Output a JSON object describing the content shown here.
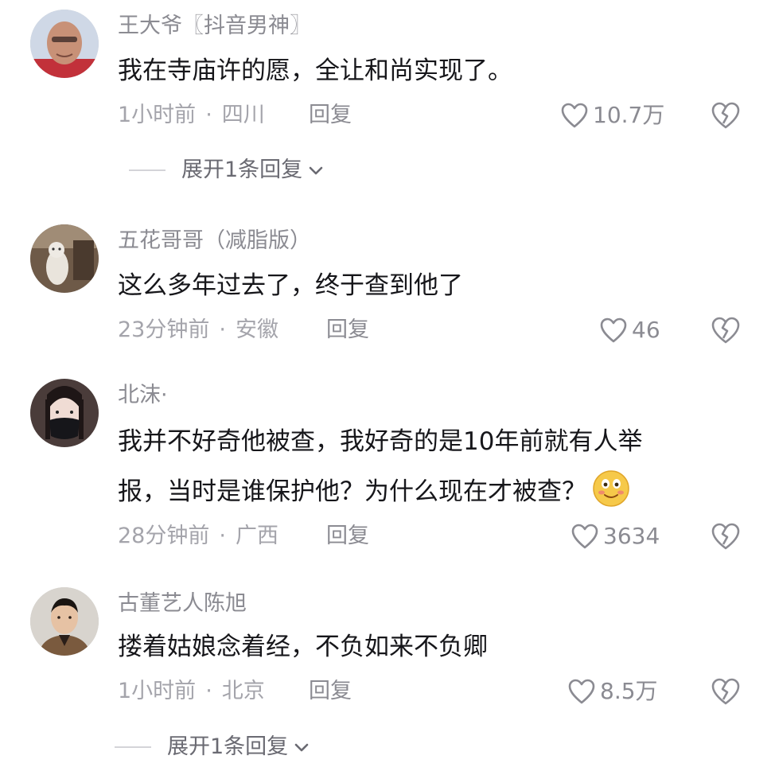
{
  "comments": [
    {
      "username": "王大爷〖抖音男神〗",
      "text_lines": [
        "我在寺庙许的愿，全让和尚实现了。"
      ],
      "time": "1小时前",
      "location": "四川",
      "reply": "回复",
      "likes": "10.7万",
      "expand": "展开1条回复"
    },
    {
      "username": "五花哥哥（减脂版）",
      "text_lines": [
        "这么多年过去了，终于查到他了"
      ],
      "time": "23分钟前",
      "location": "安徽",
      "reply": "回复",
      "likes": "46"
    },
    {
      "username": "北沫·",
      "text_lines": [
        "我并不好奇他被查，我好奇的是10年前就有人举",
        "报，当时是谁保护他？为什么现在才被查？"
      ],
      "time": "28分钟前",
      "location": "广西",
      "reply": "回复",
      "likes": "3634"
    },
    {
      "username": "古董艺人陈旭",
      "text_lines": [
        "搂着姑娘念着经，不负如来不负卿"
      ],
      "time": "1小时前",
      "location": "北京",
      "reply": "回复",
      "likes": "8.5万",
      "expand": "展开1条回复"
    }
  ],
  "icons": {
    "like": "heart-outline-icon",
    "dislike": "broken-heart-icon",
    "expand": "chevron-down-icon",
    "emoji": "smiling-face-emoji"
  },
  "colors": {
    "text": "#16161a",
    "secondary": "#8b8b92",
    "emoji_fill": "#f6c94a"
  }
}
